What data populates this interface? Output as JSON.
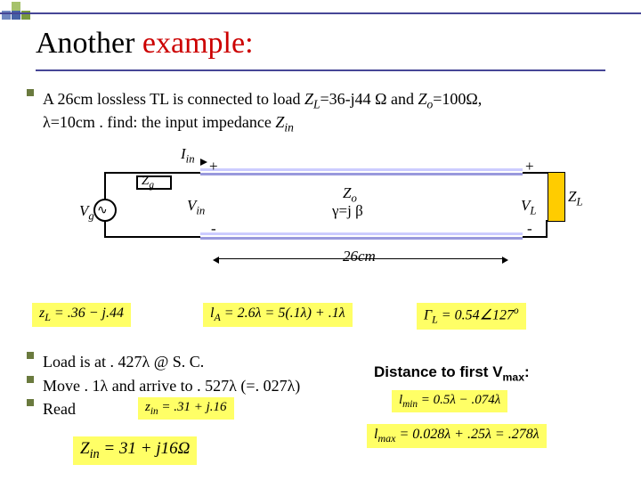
{
  "title": {
    "black": "Another ",
    "red": "example:"
  },
  "problem": {
    "line1_a": "A 26cm lossless TL is connected to load ",
    "line1_b": "=36-j44 Ω and ",
    "line1_c": "=100Ω,",
    "line2_a": "λ=10cm . find: the input impedance ",
    "ZL": "Z",
    "ZLs": "L",
    "Zo": "Z",
    "Zos": "o",
    "Zin": "Z",
    "Zins": "in"
  },
  "circuit": {
    "Iin": "I",
    "Iins": "in",
    "Vg": "V",
    "Vgs": "g",
    "Zg": "Z",
    "Zgs": "g",
    "Vin": "V",
    "Vins": "in",
    "Zo": "Z",
    "Zos": "o",
    "gamma_eq": "γ=j β",
    "VL": "V",
    "VLs": "L",
    "ZL": "Z",
    "ZLs": "L",
    "plus": "+",
    "minus": "-",
    "len": "26cm"
  },
  "calc": {
    "zL_eq": "z",
    "zL_sub": "L",
    "zL_rest": " = .36 − j.44",
    "lA_eq": "l",
    "lA_sub": "A",
    "lA_rest": " = 2.6λ = 5(.1λ) + .1λ",
    "Gamma_eq": "Γ",
    "Gamma_sub": "L",
    "Gamma_rest": " = 0.54∠127",
    "Gamma_deg": "o"
  },
  "bullets2": {
    "b1": "Load is at . 427λ @ S. C.",
    "b2_a": "Move . 1λ and arrive to . 527λ ",
    "b2_b": "(=. 027λ)",
    "b3": "Read"
  },
  "zin_small": {
    "pre": "z",
    "sub": "in",
    "rest": " = .31 + j.16"
  },
  "Zin_big": {
    "pre": "Z",
    "sub": "in",
    "rest": " = 31 + j16Ω"
  },
  "dist_label": "Distance to first V",
  "dist_label_sub": "max",
  "dist_label_colon": ":",
  "lmin": {
    "pre": "l",
    "sub": "min",
    "rest": " = 0.5λ − .074λ"
  },
  "lmax": {
    "pre": "l",
    "sub": "max",
    "rest": " = 0.028λ + .25λ = .278λ"
  }
}
